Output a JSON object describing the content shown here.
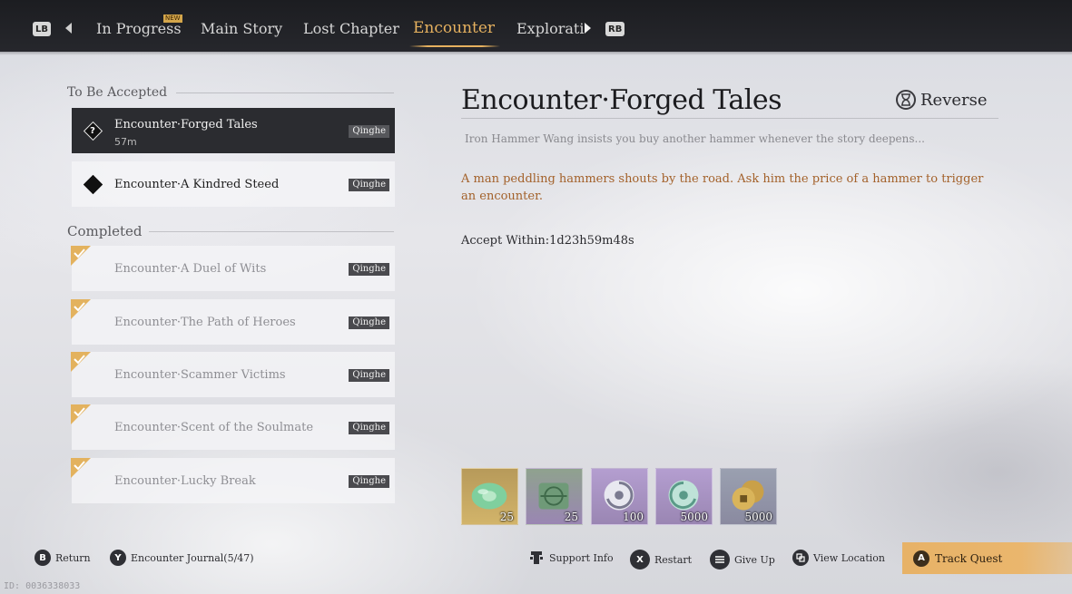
{
  "tabs": {
    "lb": "LB",
    "rb": "RB",
    "new_badge": "NEW",
    "items": [
      {
        "label": "In Progress"
      },
      {
        "label": "Main Story"
      },
      {
        "label": "Lost Chapter"
      },
      {
        "label": "Encounter"
      },
      {
        "label": "Explorati"
      }
    ],
    "active": "Encounter"
  },
  "left": {
    "to_be_accepted_title": "To Be Accepted",
    "completed_title": "Completed",
    "accepted": [
      {
        "name": "Encounter·Forged Tales",
        "time": "57m",
        "tag": "Qinghe",
        "icon": "question-diamond-icon"
      },
      {
        "name": "Encounter·A Kindred Steed",
        "tag": "Qinghe",
        "icon": "diamond-icon"
      }
    ],
    "completed": [
      {
        "name": "Encounter·A Duel of Wits",
        "tag": "Qinghe"
      },
      {
        "name": "Encounter·The Path of Heroes",
        "tag": "Qinghe"
      },
      {
        "name": "Encounter·Scammer Victims",
        "tag": "Qinghe"
      },
      {
        "name": "Encounter·Scent of the Soulmate",
        "tag": "Qinghe"
      },
      {
        "name": "Encounter·Lucky Break",
        "tag": "Qinghe"
      }
    ]
  },
  "detail": {
    "title": "Encounter·Forged Tales",
    "reverse_label": "Reverse",
    "summary": "Iron Hammer Wang insists you buy another hammer whenever the story deepens...",
    "description": "A man peddling hammers shouts by the road. Ask him the price of a hammer to trigger an encounter.",
    "accept_within": "Accept Within:1d23h59m48s"
  },
  "rewards": [
    {
      "count": "25",
      "icon": "jade-icon"
    },
    {
      "count": "25",
      "icon": "ore-icon"
    },
    {
      "count": "100",
      "icon": "swirl-icon"
    },
    {
      "count": "5000",
      "icon": "wind-icon"
    },
    {
      "count": "5000",
      "icon": "coins-icon"
    }
  ],
  "footer": {
    "return_key": "B",
    "return_label": "Return",
    "journal_key": "Y",
    "journal_label": "Encounter Journal(5/47)",
    "support_label": "Support Info",
    "restart_key": "X",
    "restart_label": "Restart",
    "giveup_label": "Give Up",
    "view_location_label": "View Location",
    "track_key": "A",
    "track_label": "Track Quest",
    "id_text": "ID: 0036338033"
  },
  "colors": {
    "accent": "#e6b15f",
    "description": "#a3612a",
    "topbar": "#1c1d21"
  }
}
